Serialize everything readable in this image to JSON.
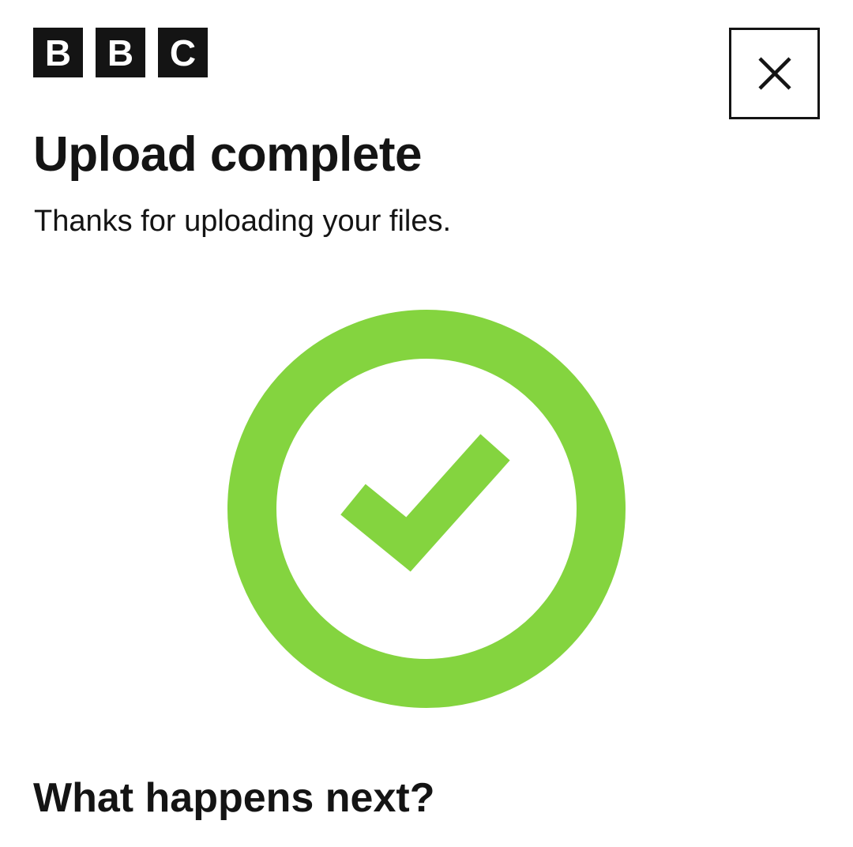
{
  "header": {
    "logo_letters": [
      "B",
      "B",
      "C"
    ],
    "close_icon": "close-icon"
  },
  "main": {
    "title": "Upload complete",
    "subtitle": "Thanks for uploading your files.",
    "status_icon": "check-circle-icon",
    "status_color": "#84D43F",
    "next_heading": "What happens next?"
  },
  "colors": {
    "text": "#141414",
    "background": "#FFFFFF",
    "logo_background": "#141414",
    "success": "#84D43F"
  }
}
